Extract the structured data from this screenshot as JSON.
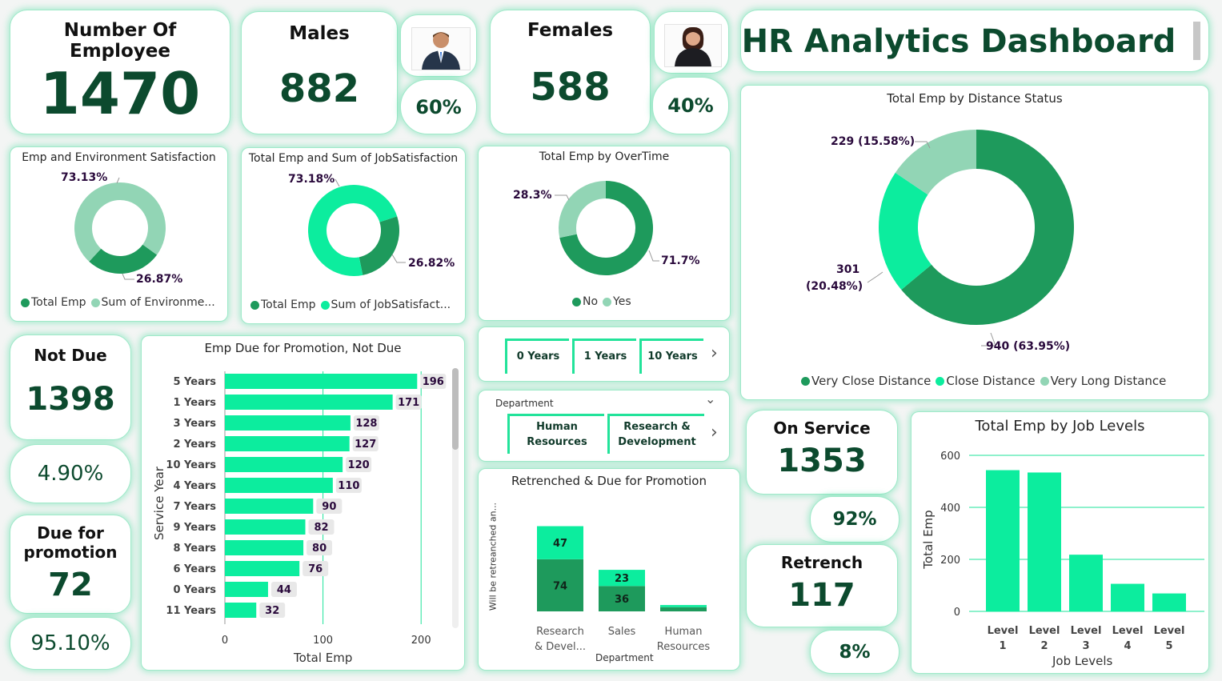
{
  "kpis": {
    "employees": {
      "title": "Number Of Employee",
      "value": "1470"
    },
    "males": {
      "title": "Males",
      "value": "882",
      "pct": "60%"
    },
    "females": {
      "title": "Females",
      "value": "588",
      "pct": "40%"
    },
    "not_due": {
      "title": "Not Due",
      "value": "1398",
      "pct": "4.90%"
    },
    "due": {
      "title_l1": "Due for",
      "title_l2": "promotion",
      "value": "72",
      "pct": "95.10%"
    },
    "on_service": {
      "title": "On Service",
      "value": "1353",
      "pct": "92%"
    },
    "retrench": {
      "title": "Retrench",
      "value": "117",
      "pct": "8%"
    }
  },
  "dashboard_title": "HR Analytics Dashboard",
  "icons": {
    "male": "male-user-icon",
    "female": "female-user-icon",
    "chevron": "chevron-right-icon",
    "dropdown": "chevron-down-icon"
  },
  "colors": {
    "dark": "#1e9a5c",
    "bright": "#0ced9e",
    "light": "#92d5b5",
    "text": "#0c4a2e"
  },
  "slicers": {
    "years": [
      "0 Years",
      "1 Years",
      "10 Years"
    ],
    "department": {
      "label": "Department",
      "options": [
        "Human Resources",
        "Research & Development"
      ]
    }
  },
  "chart_data": [
    {
      "id": "env",
      "type": "pie",
      "title": "Emp and Environment Satisfaction",
      "labels": [
        "Total Emp",
        "Sum of Environme..."
      ],
      "values": [
        26.87,
        73.13
      ],
      "data_labels": [
        "26.87%",
        "73.13%"
      ],
      "colors": [
        "#1e9a5c",
        "#92d5b5"
      ]
    },
    {
      "id": "job",
      "type": "pie",
      "title": "Total Emp and Sum of JobSatisfaction",
      "labels": [
        "Total Emp",
        "Sum of JobSatisfact..."
      ],
      "values": [
        26.82,
        73.18
      ],
      "data_labels": [
        "26.82%",
        "73.18%"
      ],
      "colors": [
        "#1e9a5c",
        "#0ced9e"
      ]
    },
    {
      "id": "ot",
      "type": "pie",
      "title": "Total Emp by OverTime",
      "labels": [
        "No",
        "Yes"
      ],
      "values": [
        71.7,
        28.3
      ],
      "data_labels": [
        "71.7%",
        "28.3%"
      ],
      "colors": [
        "#1e9a5c",
        "#92d5b5"
      ]
    },
    {
      "id": "dist",
      "type": "pie",
      "title": "Total Emp by Distance Status",
      "labels": [
        "Very Close Distance",
        "Close Distance",
        "Very Long Distance"
      ],
      "values": [
        940,
        301,
        229
      ],
      "data_labels": [
        "940 (63.95%)",
        "301",
        "(20.48%)",
        "229 (15.58%)"
      ],
      "colors": [
        "#1e9a5c",
        "#0ced9e",
        "#92d5b5"
      ]
    },
    {
      "id": "promo",
      "type": "bar",
      "orientation": "horizontal",
      "title": "Emp Due for Promotion, Not Due",
      "categories": [
        "5 Years",
        "1 Years",
        "3 Years",
        "2 Years",
        "10 Years",
        "4 Years",
        "7 Years",
        "9 Years",
        "8 Years",
        "6 Years",
        "0 Years",
        "11 Years"
      ],
      "values": [
        196,
        171,
        128,
        127,
        120,
        110,
        90,
        82,
        80,
        76,
        44,
        32
      ],
      "xlabel": "Total Emp",
      "ylabel": "Service Year",
      "xticks": [
        "0",
        "100",
        "200"
      ],
      "xlim": [
        0,
        220
      ]
    },
    {
      "id": "retr",
      "type": "bar",
      "stacked": true,
      "title": "Retrenched & Due for Promotion",
      "categories": [
        "Research & Devel...",
        "Sales",
        "Human Resources"
      ],
      "series": [
        {
          "values": [
            74,
            36,
            6
          ],
          "color": "#1e9a5c"
        },
        {
          "values": [
            47,
            23,
            3
          ],
          "color": "#0ced9e"
        }
      ],
      "xlabel": "Department",
      "ylabel": "Will be retreanched an...",
      "ylim": [
        0,
        130
      ]
    },
    {
      "id": "levels",
      "type": "bar",
      "title": "Total Emp by Job Levels",
      "categories": [
        "Level 1",
        "Level 2",
        "Level 3",
        "Level 4",
        "Level 5"
      ],
      "values": [
        543,
        534,
        218,
        106,
        69
      ],
      "xlabel": "Job Levels",
      "ylabel": "Total Emp",
      "yticks": [
        "0",
        "200",
        "400",
        "600"
      ],
      "ylim": [
        0,
        600
      ]
    }
  ]
}
